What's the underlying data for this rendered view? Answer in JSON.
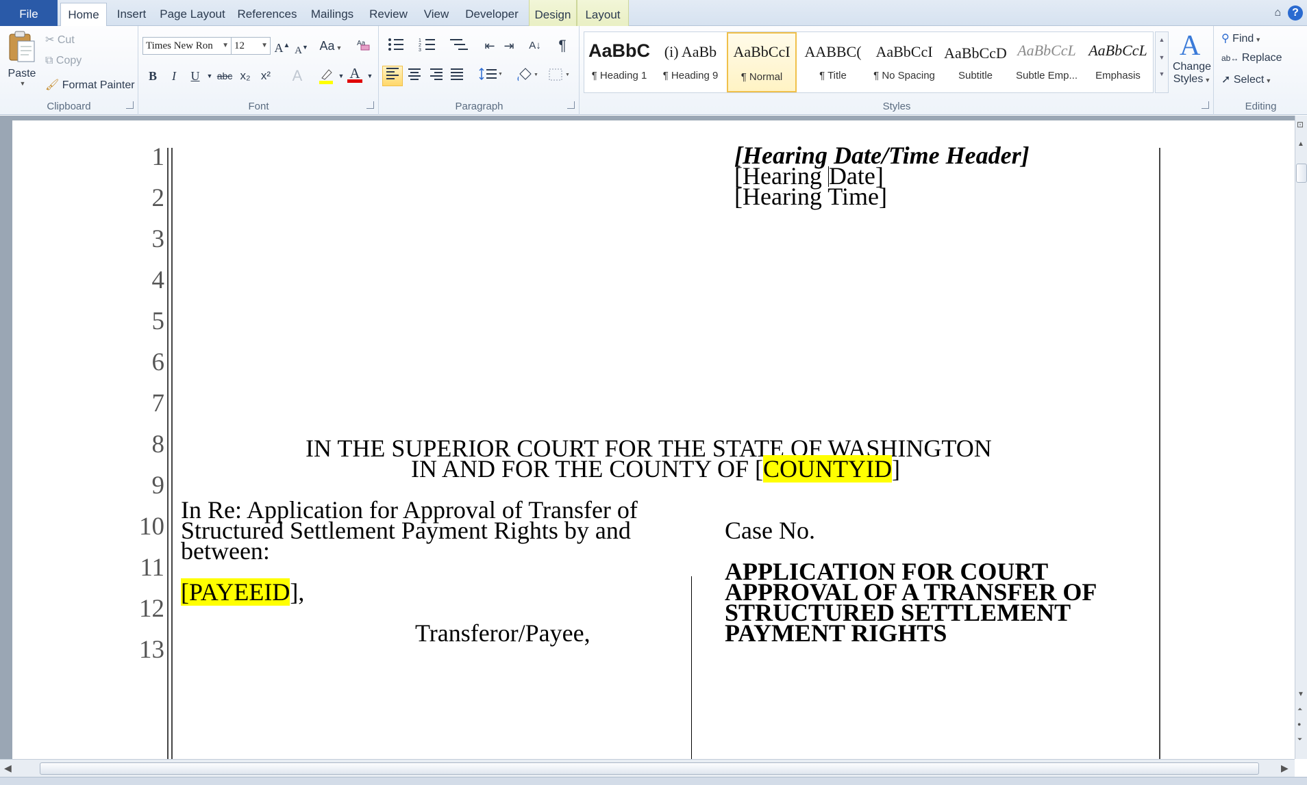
{
  "tabs": {
    "file": "File",
    "home": "Home",
    "insert": "Insert",
    "page_layout": "Page Layout",
    "references": "References",
    "mailings": "Mailings",
    "review": "Review",
    "view": "View",
    "developer": "Developer",
    "design": "Design",
    "layout": "Layout"
  },
  "clipboard": {
    "paste": "Paste",
    "cut": "Cut",
    "copy": "Copy",
    "format_painter": "Format Painter",
    "label": "Clipboard"
  },
  "font": {
    "name": "Times New Ron",
    "size": "12",
    "label": "Font",
    "change_case": "Aa",
    "bold": "B",
    "italic": "I",
    "underline": "U",
    "strike": "abc",
    "subscript": "x₂",
    "superscript": "x²",
    "font_color_letter": "A",
    "font_color": "#e00000",
    "highlight_color": "#ffff00"
  },
  "paragraph": {
    "label": "Paragraph",
    "pilcrow": "¶"
  },
  "styles": {
    "label": "Styles",
    "items": [
      {
        "sample": "AaBbC",
        "name": "¶ Heading 1"
      },
      {
        "sample": "(i)  AaBb",
        "name": "¶ Heading 9"
      },
      {
        "sample": "AaBbCcI",
        "name": "¶ Normal"
      },
      {
        "sample": "AABBC(",
        "name": "¶ Title"
      },
      {
        "sample": "AaBbCcI",
        "name": "¶ No Spacing"
      },
      {
        "sample": "AaBbCcD",
        "name": "Subtitle"
      },
      {
        "sample": "AaBbCcL",
        "name": "Subtle Emp..."
      },
      {
        "sample": "AaBbCcL",
        "name": "Emphasis"
      }
    ],
    "change_styles": "Change",
    "change_styles_2": "Styles"
  },
  "editing": {
    "find": "Find",
    "replace": "Replace",
    "select": "Select",
    "label": "Editing"
  },
  "document": {
    "line_numbers": [
      "1",
      "2",
      "3",
      "4",
      "5",
      "6",
      "7",
      "8",
      "9",
      "10",
      "11",
      "12",
      "13"
    ],
    "header_title": "[Hearing Date/Time Header]",
    "hearing_date_a": "[Hearing ",
    "hearing_date_b": "Date]",
    "hearing_time": "[Hearing Time]",
    "court_line1": "IN THE SUPERIOR COURT FOR THE STATE OF WASHINGTON",
    "court_line2_prefix": "IN AND FOR THE COUNTY OF [",
    "county_id": "COUNTYID",
    "court_line2_suffix": "]",
    "in_re_1": "In Re:  Application  for Approval of Transfer of",
    "in_re_2": "Structured Settlement Payment Rights by and",
    "in_re_3": "between:",
    "payee_prefix": "[",
    "payee_id": "PAYEEID",
    "payee_suffix": "],",
    "transferor": "Transferor/Payee,",
    "case_no": "Case No.",
    "app_title_1": "APPLICATION FOR COURT",
    "app_title_2": "APPROVAL OF A TRANSFER OF",
    "app_title_3": "STRUCTURED SETTLEMENT",
    "app_title_4": "PAYMENT RIGHTS"
  }
}
